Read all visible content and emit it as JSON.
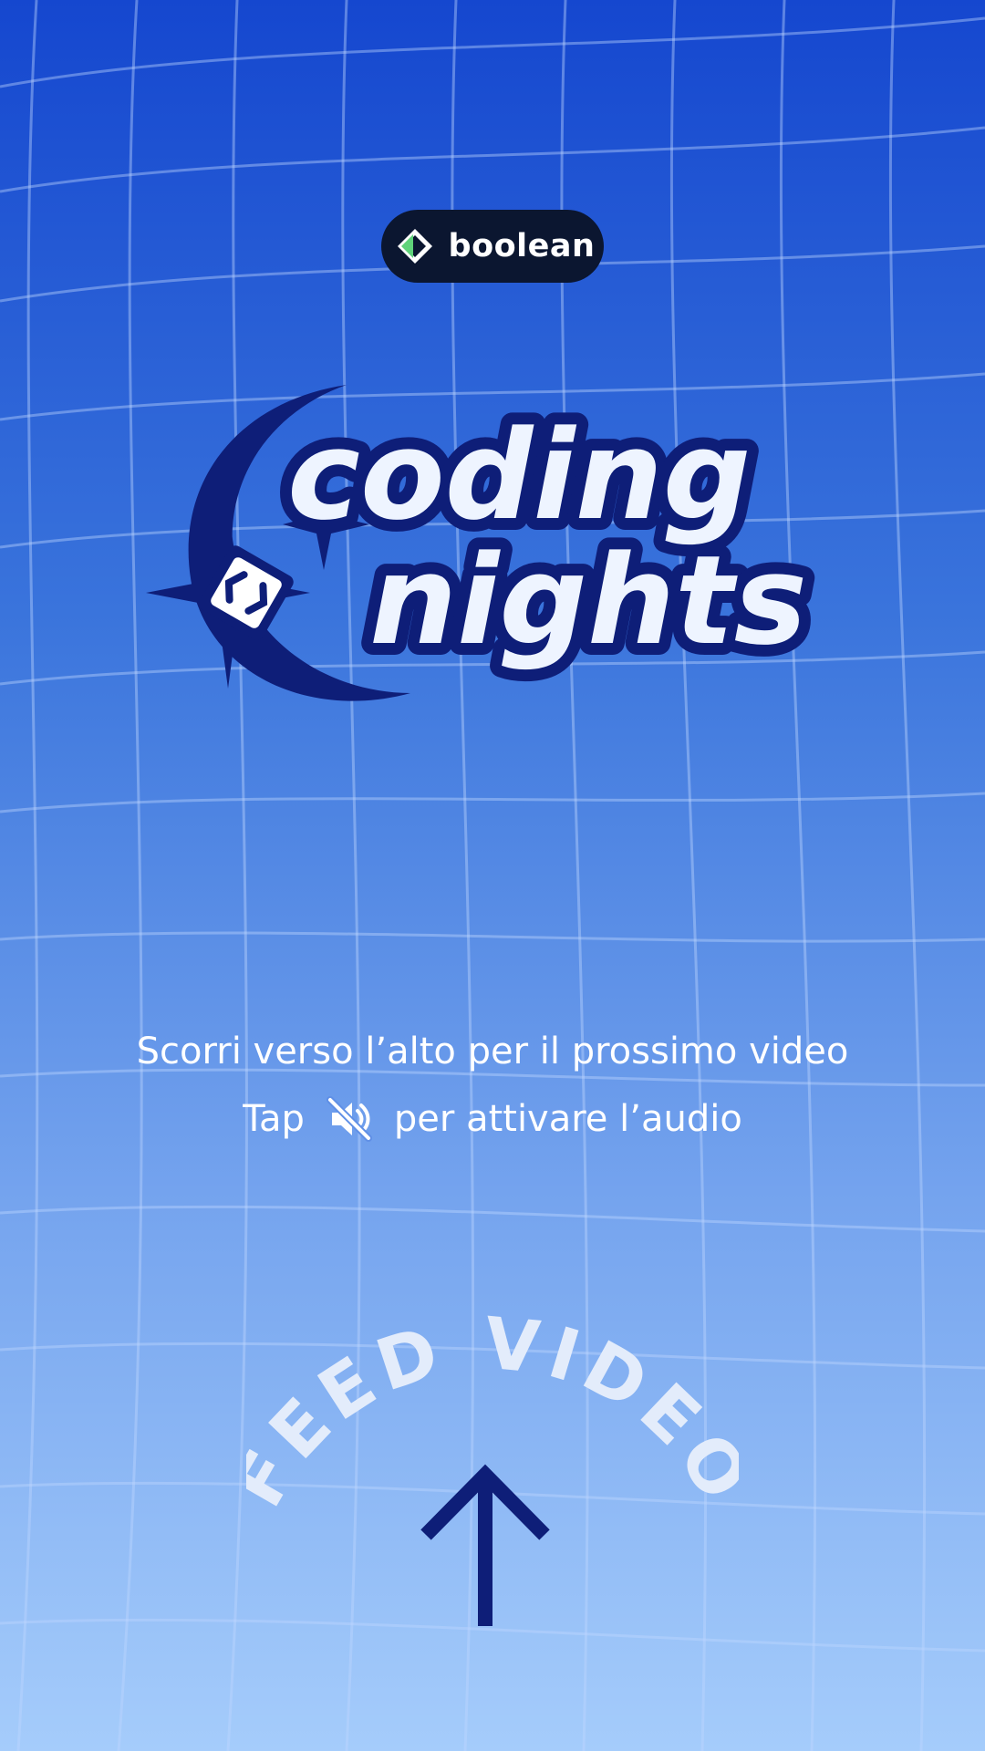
{
  "brand": {
    "name": "boolean",
    "icon": "diamond-code-icon",
    "accent": "#5fd37a"
  },
  "logo": {
    "line1": "coding",
    "line2": "nights",
    "fill": "#eef4ff",
    "outline": "#0e1e78"
  },
  "hints": {
    "swipe": "Scorri verso l’alto per il prossimo video",
    "tap": "Tap",
    "tap_suffix": "per attivare l’audio",
    "mute_icon": "speaker-muted-icon"
  },
  "feed": {
    "label": "FEED VIDEO",
    "arrow_icon": "arrow-up-icon"
  },
  "colors": {
    "bg_top": "#1547cf",
    "bg_bottom": "#a5ccfb",
    "navy": "#0e1e78"
  }
}
